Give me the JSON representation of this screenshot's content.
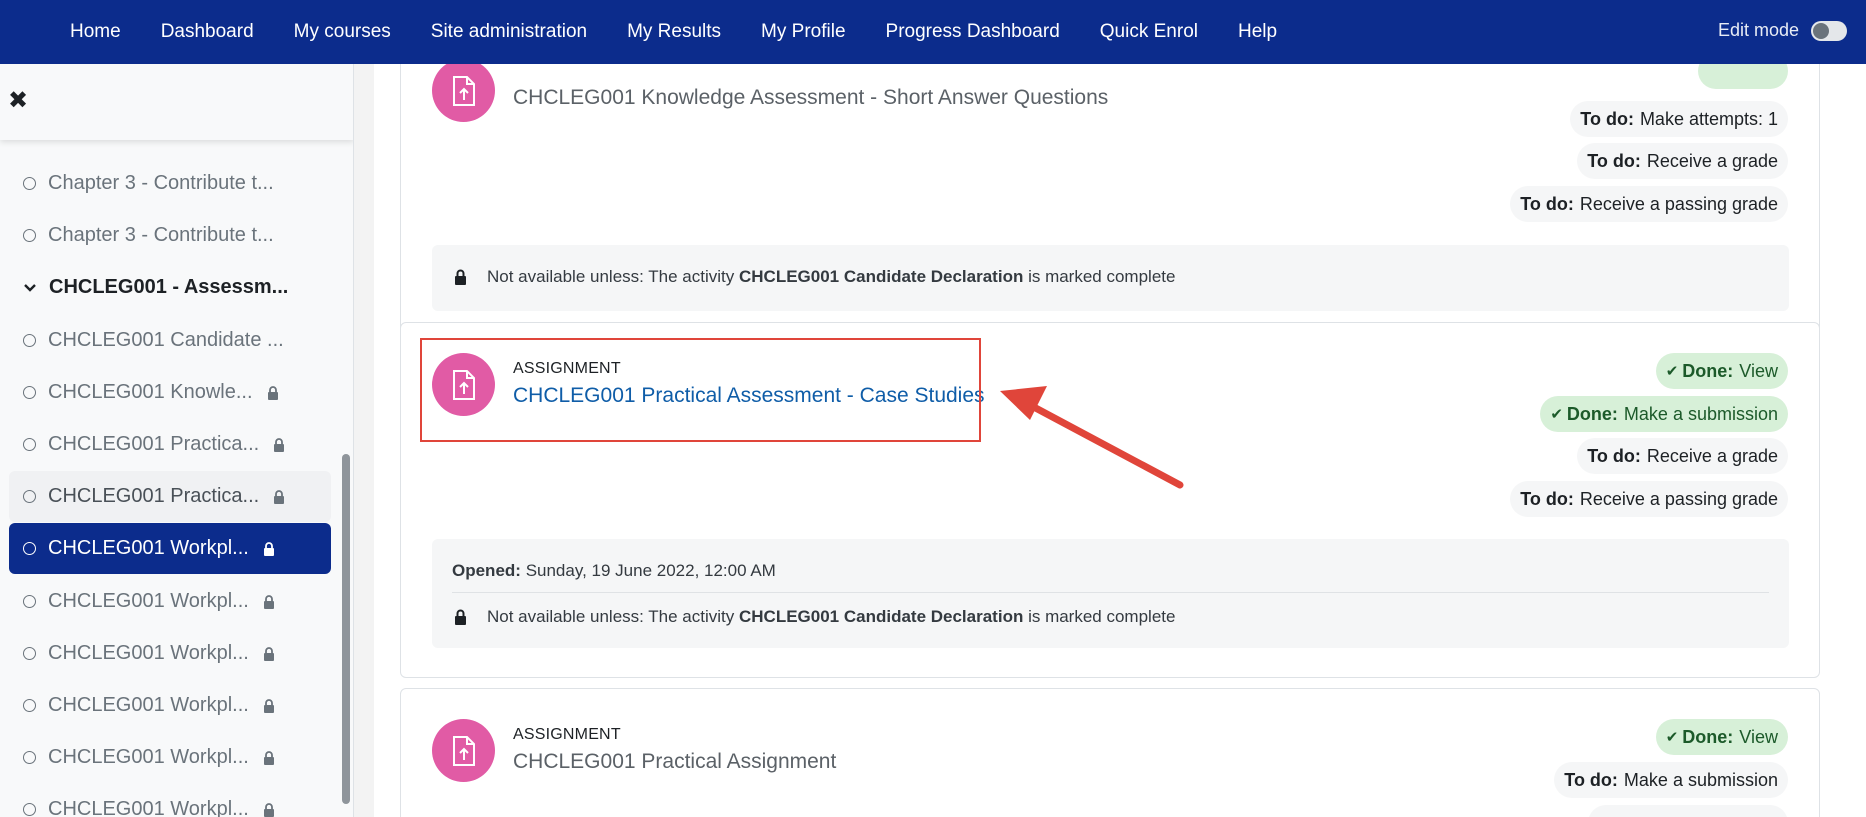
{
  "nav": {
    "links": [
      "Home",
      "Dashboard",
      "My courses",
      "Site administration",
      "My Results",
      "My Profile",
      "Progress Dashboard",
      "Quick Enrol",
      "Help"
    ],
    "edit_mode_label": "Edit mode"
  },
  "drawer": {
    "items": [
      {
        "label": "Chapter 3 - Contribute t...",
        "lock": false,
        "state": "normal"
      },
      {
        "label": "Chapter 3 - Contribute t...",
        "lock": false,
        "state": "normal"
      },
      {
        "label": "CHCLEG001 - Assessm...",
        "lock": false,
        "state": "section"
      },
      {
        "label": "CHCLEG001 Candidate ...",
        "lock": false,
        "state": "normal"
      },
      {
        "label": "CHCLEG001 Knowle...",
        "lock": true,
        "state": "normal"
      },
      {
        "label": "CHCLEG001 Practica...",
        "lock": true,
        "state": "normal"
      },
      {
        "label": "CHCLEG001 Practica...",
        "lock": true,
        "state": "hover"
      },
      {
        "label": "CHCLEG001 Workpl...",
        "lock": true,
        "state": "active"
      },
      {
        "label": "CHCLEG001 Workpl...",
        "lock": true,
        "state": "normal"
      },
      {
        "label": "CHCLEG001 Workpl...",
        "lock": true,
        "state": "normal"
      },
      {
        "label": "CHCLEG001 Workpl...",
        "lock": true,
        "state": "normal"
      },
      {
        "label": "CHCLEG001 Workpl...",
        "lock": true,
        "state": "normal"
      },
      {
        "label": "CHCLEG001 Workpl...",
        "lock": true,
        "state": "normal"
      }
    ]
  },
  "activities": [
    {
      "name": "CHCLEG001 Knowledge Assessment - Short Answer Questions",
      "badges": [
        {
          "status": "To do:",
          "text": "Make attempts: 1"
        },
        {
          "status": "To do:",
          "text": "Receive a grade"
        },
        {
          "status": "To do:",
          "text": "Receive a passing grade"
        }
      ],
      "restriction": {
        "prefix": "Not available unless: The activity ",
        "activity": "CHCLEG001 Candidate Declaration",
        "suffix": " is marked complete"
      }
    },
    {
      "type": "ASSIGNMENT",
      "name": "CHCLEG001 Practical Assessment - Case Studies",
      "badges": [
        {
          "status": "Done:",
          "text": "View"
        },
        {
          "status": "Done:",
          "text": "Make a submission"
        },
        {
          "status": "To do:",
          "text": "Receive a grade"
        },
        {
          "status": "To do:",
          "text": "Receive a passing grade"
        }
      ],
      "opened_label": "Opened:",
      "opened_value": "Sunday, 19 June 2022, 12:00 AM",
      "restriction": {
        "prefix": "Not available unless: The activity ",
        "activity": "CHCLEG001 Candidate Declaration",
        "suffix": " is marked complete"
      }
    },
    {
      "type": "ASSIGNMENT",
      "name": "CHCLEG001 Practical Assignment",
      "badges": [
        {
          "status": "Done:",
          "text": "View"
        },
        {
          "status": "To do:",
          "text": "Make a submission"
        }
      ]
    }
  ],
  "colors": {
    "nav_bg": "#0c2c8c",
    "activity_icon": "#e15ba5",
    "done_badge": "#d7f0d8",
    "highlight": "#e0453a"
  },
  "icons": {
    "close": "close-icon",
    "lock": "lock-icon",
    "assignment": "assignment-upload-icon",
    "check": "check-icon",
    "chevron": "chevron-down-icon"
  }
}
